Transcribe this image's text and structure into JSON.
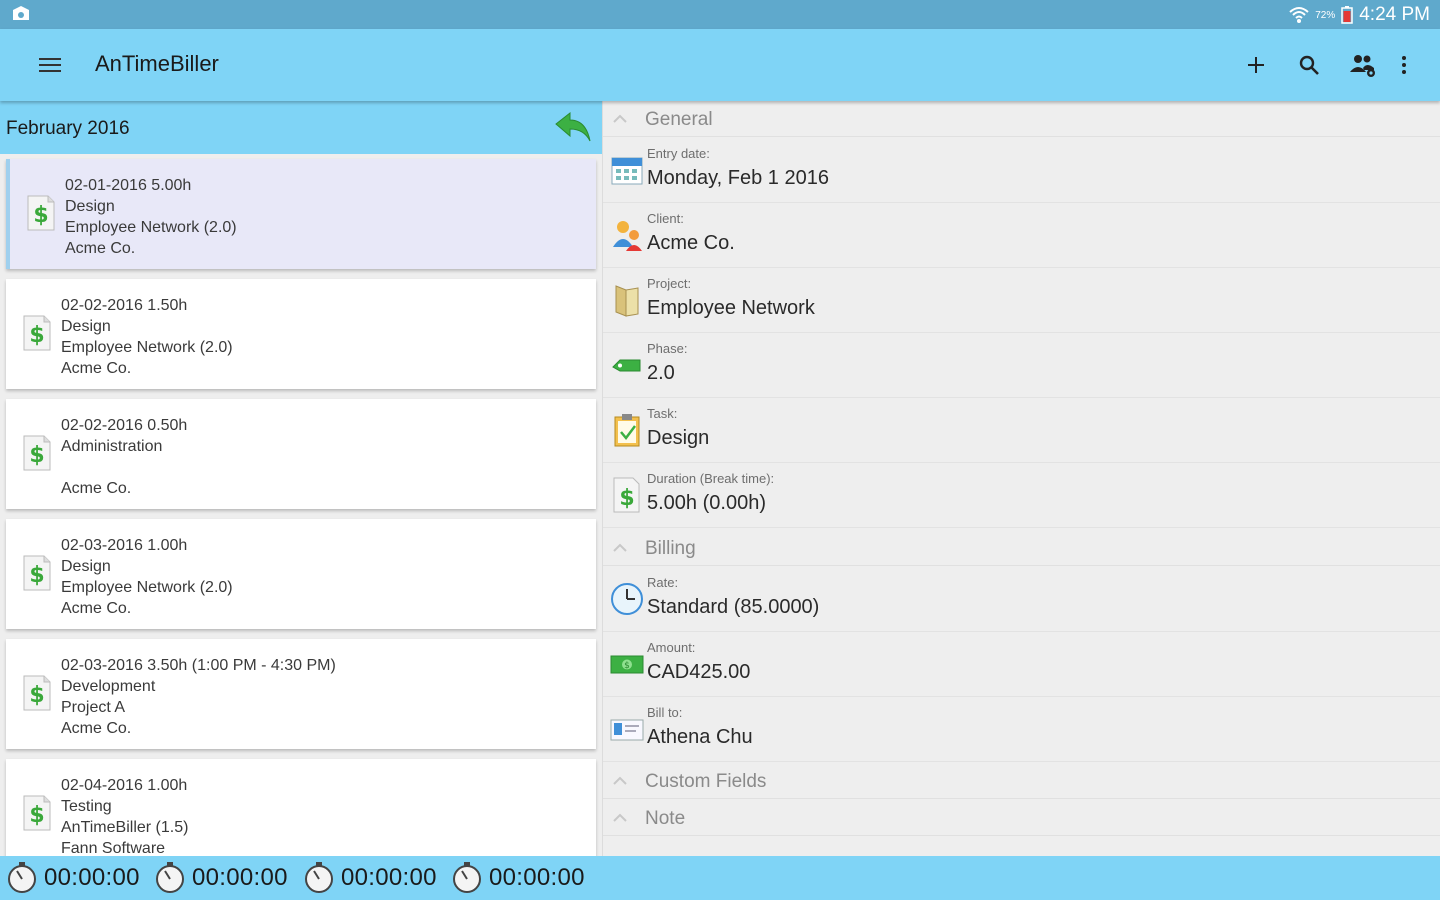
{
  "status_bar": {
    "battery": "72%",
    "time": "4:24 PM"
  },
  "app_bar": {
    "title": "AnTimeBiller"
  },
  "left_pane": {
    "month": "February 2016",
    "entries": [
      {
        "line1": "02-01-2016 5.00h",
        "line2": "Design",
        "line3": "Employee Network (2.0)",
        "line4": "Acme Co."
      },
      {
        "line1": "02-02-2016 1.50h",
        "line2": "Design",
        "line3": "Employee Network (2.0)",
        "line4": "Acme Co."
      },
      {
        "line1": "02-02-2016 0.50h",
        "line2": "Administration",
        "line3": "",
        "line4": "Acme Co."
      },
      {
        "line1": "02-03-2016 1.00h",
        "line2": "Design",
        "line3": "Employee Network (2.0)",
        "line4": "Acme Co."
      },
      {
        "line1": "02-03-2016 3.50h (1:00 PM - 4:30 PM)",
        "line2": "Development",
        "line3": "Project A",
        "line4": "Acme Co."
      },
      {
        "line1": "02-04-2016 1.00h",
        "line2": "Testing",
        "line3": "AnTimeBiller (1.5)",
        "line4": "Fann Software"
      }
    ]
  },
  "details": {
    "general": {
      "title": "General",
      "fields": [
        {
          "label": "Entry date:",
          "value": "Monday, Feb 1 2016",
          "icon": "calendar-icon"
        },
        {
          "label": "Client:",
          "value": "Acme Co.",
          "icon": "client-icon"
        },
        {
          "label": "Project:",
          "value": "Employee Network",
          "icon": "project-folder-icon"
        },
        {
          "label": "Phase:",
          "value": "2.0",
          "icon": "phase-tag-icon"
        },
        {
          "label": "Task:",
          "value": "Design",
          "icon": "task-clipboard-icon"
        },
        {
          "label": "Duration (Break time):",
          "value": "5.00h (0.00h)",
          "icon": "dollar-document-icon"
        }
      ]
    },
    "billing": {
      "title": "Billing",
      "fields": [
        {
          "label": "Rate:",
          "value": "Standard (85.0000)",
          "icon": "clock-icon"
        },
        {
          "label": "Amount:",
          "value": "CAD425.00",
          "icon": "money-icon"
        },
        {
          "label": "Bill to:",
          "value": "Athena Chu",
          "icon": "contact-card-icon"
        }
      ]
    },
    "custom_fields": {
      "title": "Custom Fields"
    },
    "note": {
      "title": "Note"
    }
  },
  "timers": [
    "00:00:00",
    "00:00:00",
    "00:00:00",
    "00:00:00"
  ],
  "colors": {
    "app_bar": "#7fd4f6",
    "status_bar": "#5fa9cc",
    "selected_entry": "#e8e8f8",
    "back_arrow": "#3cb043"
  }
}
